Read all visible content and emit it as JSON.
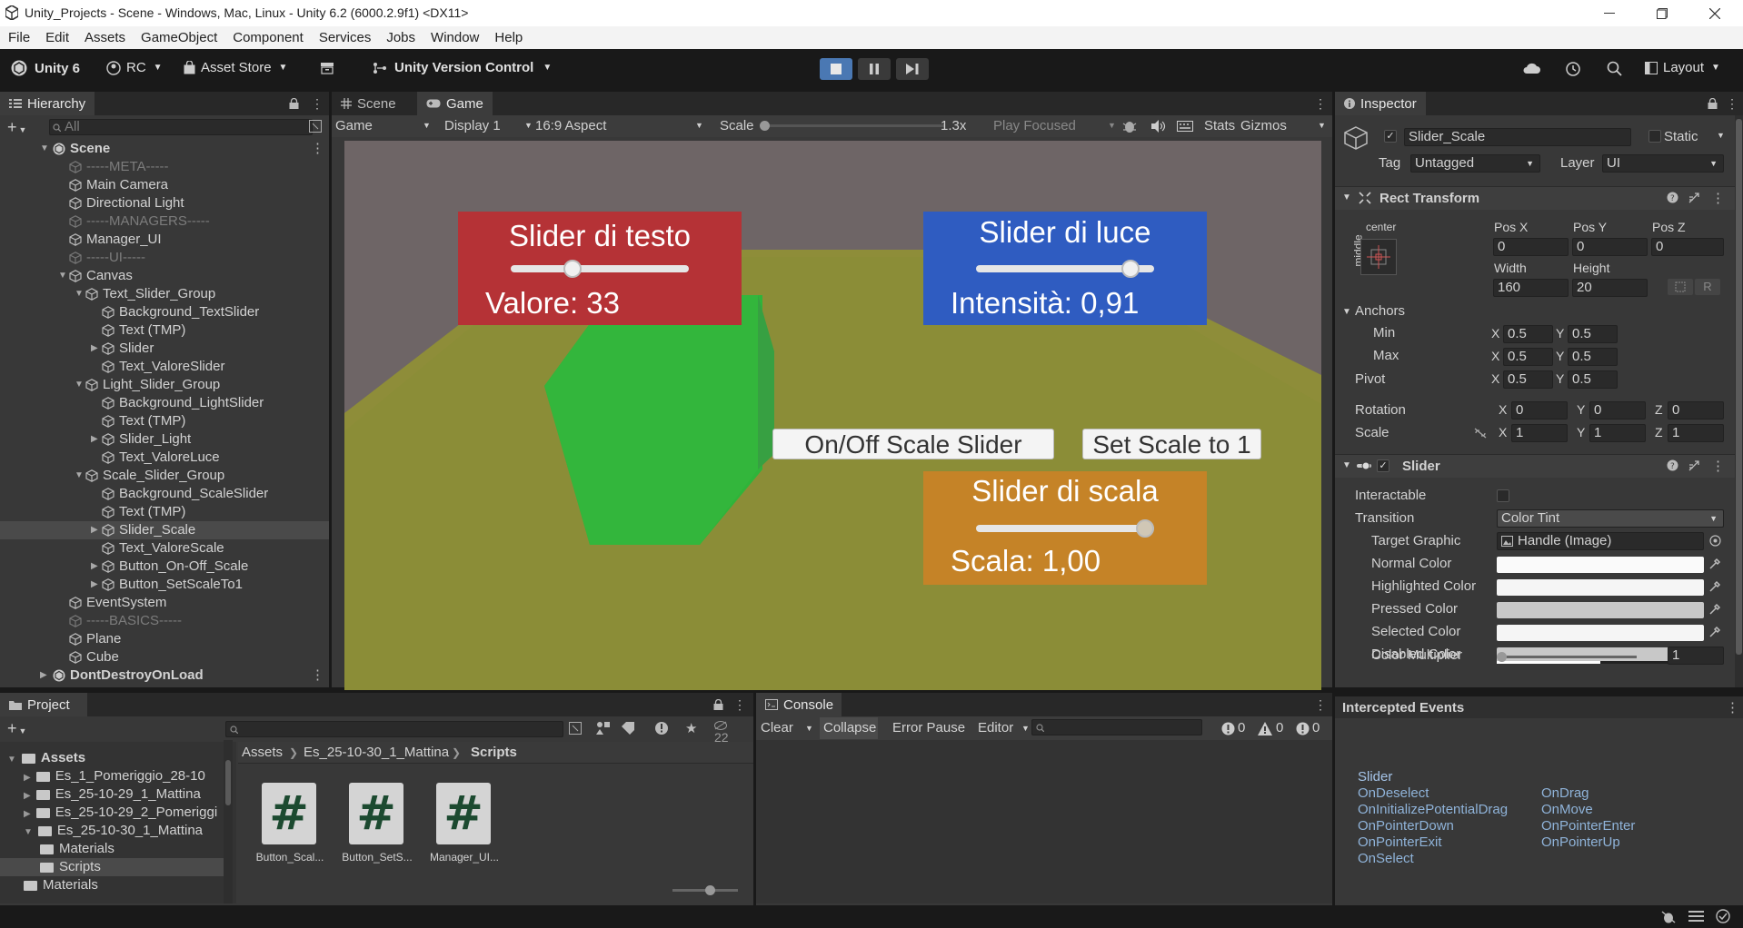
{
  "window": {
    "title": "Unity_Projects - Scene - Windows, Mac, Linux - Unity 6.2 (6000.2.9f1) <DX11>"
  },
  "menu": [
    "File",
    "Edit",
    "Assets",
    "GameObject",
    "Component",
    "Services",
    "Jobs",
    "Window",
    "Help"
  ],
  "toolbar": {
    "unity": "Unity 6",
    "account": "RC",
    "asset_store": "Asset Store",
    "version_control": "Unity Version Control",
    "layout": "Layout"
  },
  "hierarchy": {
    "tab": "Hierarchy",
    "search_placeholder": "All",
    "rows": [
      {
        "label": "Scene",
        "depth": 0,
        "expanded": true,
        "scene": true
      },
      {
        "label": "-----META-----",
        "depth": 1,
        "grey": true
      },
      {
        "label": "Main Camera",
        "depth": 1
      },
      {
        "label": "Directional Light",
        "depth": 1
      },
      {
        "label": "-----MANAGERS-----",
        "depth": 1,
        "grey": true
      },
      {
        "label": "Manager_UI",
        "depth": 1
      },
      {
        "label": "-----UI-----",
        "depth": 1,
        "grey": true
      },
      {
        "label": "Canvas",
        "depth": 1,
        "expanded": true
      },
      {
        "label": "Text_Slider_Group",
        "depth": 2,
        "expanded": true
      },
      {
        "label": "Background_TextSlider",
        "depth": 3
      },
      {
        "label": "Text (TMP)",
        "depth": 3
      },
      {
        "label": "Slider",
        "depth": 3,
        "collapsed": true
      },
      {
        "label": "Text_ValoreSlider",
        "depth": 3
      },
      {
        "label": "Light_Slider_Group",
        "depth": 2,
        "expanded": true
      },
      {
        "label": "Background_LightSlider",
        "depth": 3
      },
      {
        "label": "Text (TMP)",
        "depth": 3
      },
      {
        "label": "Slider_Light",
        "depth": 3,
        "collapsed": true
      },
      {
        "label": "Text_ValoreLuce",
        "depth": 3
      },
      {
        "label": "Scale_Slider_Group",
        "depth": 2,
        "expanded": true
      },
      {
        "label": "Background_ScaleSlider",
        "depth": 3
      },
      {
        "label": "Text (TMP)",
        "depth": 3
      },
      {
        "label": "Slider_Scale",
        "depth": 3,
        "collapsed": true,
        "selected": true
      },
      {
        "label": "Text_ValoreScale",
        "depth": 3
      },
      {
        "label": "Button_On-Off_Scale",
        "depth": 3,
        "collapsed": true
      },
      {
        "label": "Button_SetScaleTo1",
        "depth": 3,
        "collapsed": true
      },
      {
        "label": "EventSystem",
        "depth": 1
      },
      {
        "label": "-----BASICS-----",
        "depth": 1,
        "grey": true
      },
      {
        "label": "Plane",
        "depth": 1
      },
      {
        "label": "Cube",
        "depth": 1
      },
      {
        "label": "DontDestroyOnLoad",
        "depth": 0,
        "collapsed": true,
        "scene": true
      }
    ]
  },
  "game_view": {
    "tabs": [
      "Scene",
      "Game"
    ],
    "toolbar": {
      "mode": "Game",
      "display": "Display 1",
      "aspect": "16:9 Aspect",
      "scale_label": "Scale",
      "scale_value": "1.3x",
      "play_focused": "Play Focused",
      "stats": "Stats",
      "gizmos": "Gizmos"
    },
    "text_panel": {
      "title": "Slider di testo",
      "value": "Valore: 33",
      "slider_fraction": 0.33,
      "color": "#b53236"
    },
    "light_panel": {
      "title": "Slider di luce",
      "value": "Intensità: 0,91",
      "slider_fraction": 0.91,
      "color": "#2f5cc1"
    },
    "scale_panel": {
      "title": "Slider di scala",
      "value": "Scala: 1,00",
      "slider_fraction": 1.0,
      "color": "#c58327"
    },
    "btn_toggle": "On/Off Scale Slider",
    "btn_set": "Set Scale to 1"
  },
  "inspector": {
    "tab": "Inspector",
    "object_name": "Slider_Scale",
    "static_label": "Static",
    "tag_label": "Tag",
    "tag_value": "Untagged",
    "layer_label": "Layer",
    "layer_value": "UI",
    "rect_transform": {
      "title": "Rect Transform",
      "anchor_h": "center",
      "anchor_v": "middle",
      "labels": {
        "pos_x": "Pos X",
        "pos_y": "Pos Y",
        "pos_z": "Pos Z",
        "width": "Width",
        "height": "Height"
      },
      "pos_x": "0",
      "pos_y": "0",
      "pos_z": "0",
      "width": "160",
      "height": "20",
      "anchors": "Anchors",
      "min": "Min",
      "max": "Max",
      "pivot": "Pivot",
      "min_x": "0.5",
      "min_y": "0.5",
      "max_x": "0.5",
      "max_y": "0.5",
      "pivot_x": "0.5",
      "pivot_y": "0.5",
      "rotation": "Rotation",
      "rot_x": "0",
      "rot_y": "0",
      "rot_z": "0",
      "scale": "Scale",
      "scale_x": "1",
      "scale_y": "1",
      "scale_z": "1",
      "axis_x": "X",
      "axis_y": "Y",
      "axis_z": "Z",
      "blueprint": "R"
    },
    "slider": {
      "title": "Slider",
      "interactable": "Interactable",
      "transition": "Transition",
      "transition_value": "Color Tint",
      "target_graphic": "Target Graphic",
      "target_graphic_value": "Handle (Image)",
      "normal": "Normal Color",
      "highlighted": "Highlighted Color",
      "pressed": "Pressed Color",
      "selected": "Selected Color",
      "disabled": "Disabled Color",
      "multiplier": "Color Multiplier",
      "multiplier_value": "1"
    },
    "intercepted": {
      "title": "Intercepted Events",
      "group": "Slider",
      "col1": [
        "OnDeselect",
        "OnInitializePotentialDrag",
        "OnPointerDown",
        "OnPointerExit",
        "OnSelect"
      ],
      "col2": [
        "OnDrag",
        "OnMove",
        "OnPointerEnter",
        "OnPointerUp"
      ]
    }
  },
  "project": {
    "tab": "Project",
    "hidden_count": "22",
    "breadcrumb": [
      "Assets",
      "Es_25-10-30_1_Mattina",
      "Scripts"
    ],
    "tree": [
      {
        "label": "Assets",
        "depth": 0,
        "bold": true
      },
      {
        "label": "Es_1_Pomeriggio_28-10",
        "depth": 1
      },
      {
        "label": "Es_25-10-29_1_Mattina",
        "depth": 1
      },
      {
        "label": "Es_25-10-29_2_Pomeriggi",
        "depth": 1
      },
      {
        "label": "Es_25-10-30_1_Mattina",
        "depth": 1,
        "expanded": true
      },
      {
        "label": "Materials",
        "depth": 2
      },
      {
        "label": "Scripts",
        "depth": 2,
        "selected": true
      },
      {
        "label": "Materials",
        "depth": 1
      }
    ],
    "assets": [
      "Button_Scal...",
      "Button_SetS...",
      "Manager_UI..."
    ]
  },
  "console": {
    "tab": "Console",
    "clear": "Clear",
    "collapse": "Collapse",
    "error_pause": "Error Pause",
    "editor": "Editor",
    "errors": "0",
    "warnings": "0",
    "logs": "0"
  }
}
